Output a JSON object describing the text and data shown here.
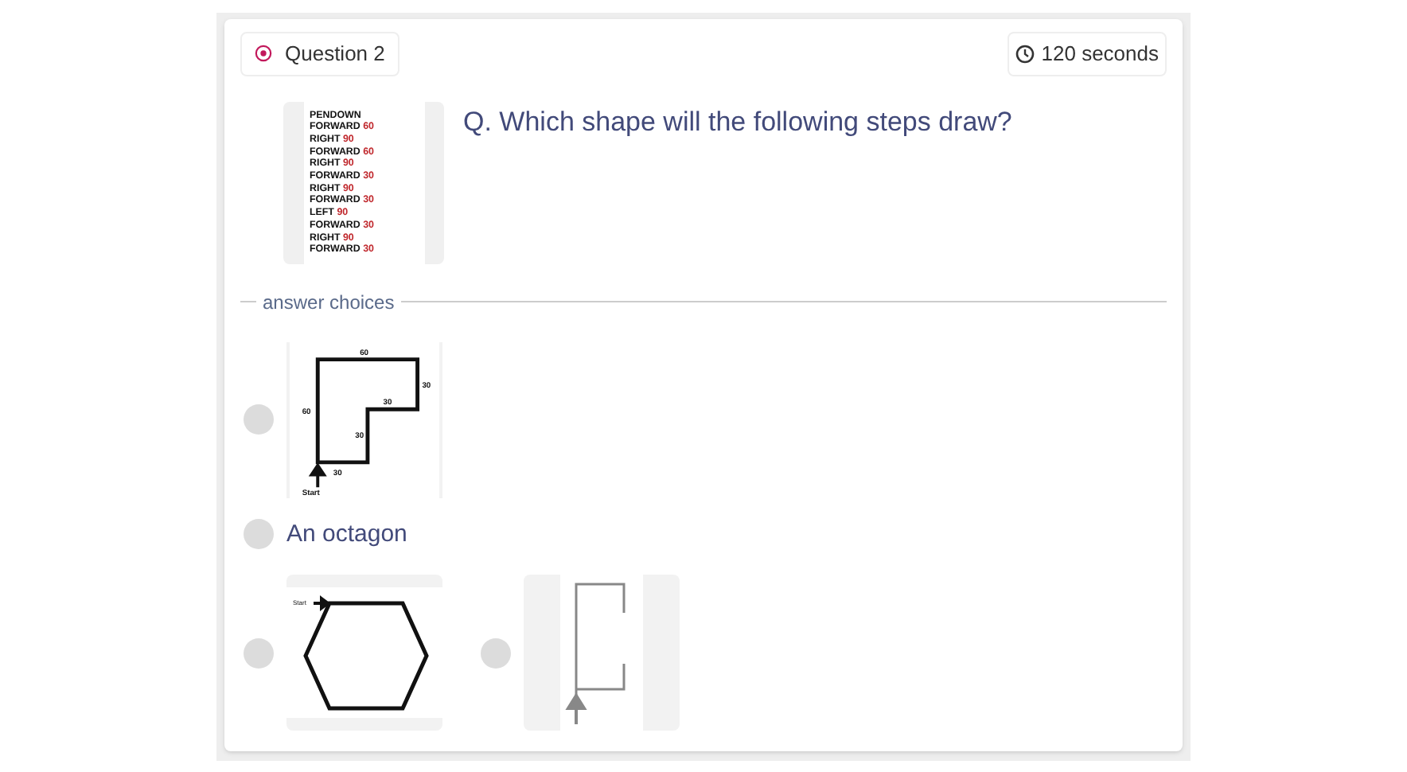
{
  "header": {
    "question_label": "Question 2",
    "timer": "120 seconds"
  },
  "code_lines": [
    {
      "command": "PENDOWN"
    },
    {
      "command": "FORWARD",
      "value": "60"
    },
    {
      "command": "RIGHT",
      "value": "90"
    },
    {
      "command": "FORWARD",
      "value": "60"
    },
    {
      "command": "RIGHT",
      "value": "90"
    },
    {
      "command": "FORWARD",
      "value": "30"
    },
    {
      "command": "RIGHT",
      "value": "90"
    },
    {
      "command": "FORWARD",
      "value": "30"
    },
    {
      "command": "LEFT",
      "value": "90"
    },
    {
      "command": "FORWARD",
      "value": "30"
    },
    {
      "command": "RIGHT",
      "value": "90"
    },
    {
      "command": "FORWARD",
      "value": "30"
    }
  ],
  "question": "Q. Which shape will the following steps draw?",
  "answer_choices_label": "answer choices",
  "choices": [
    {
      "kind": "l-shape",
      "selected": false,
      "labels": [
        "60",
        "60",
        "30",
        "30",
        "30",
        "30",
        "Start"
      ]
    },
    {
      "kind": "text",
      "selected": false,
      "text": "An octagon"
    },
    {
      "kind": "hexagon",
      "selected": false,
      "labels": [
        "Start"
      ]
    },
    {
      "kind": "bracket",
      "selected": false
    }
  ]
}
